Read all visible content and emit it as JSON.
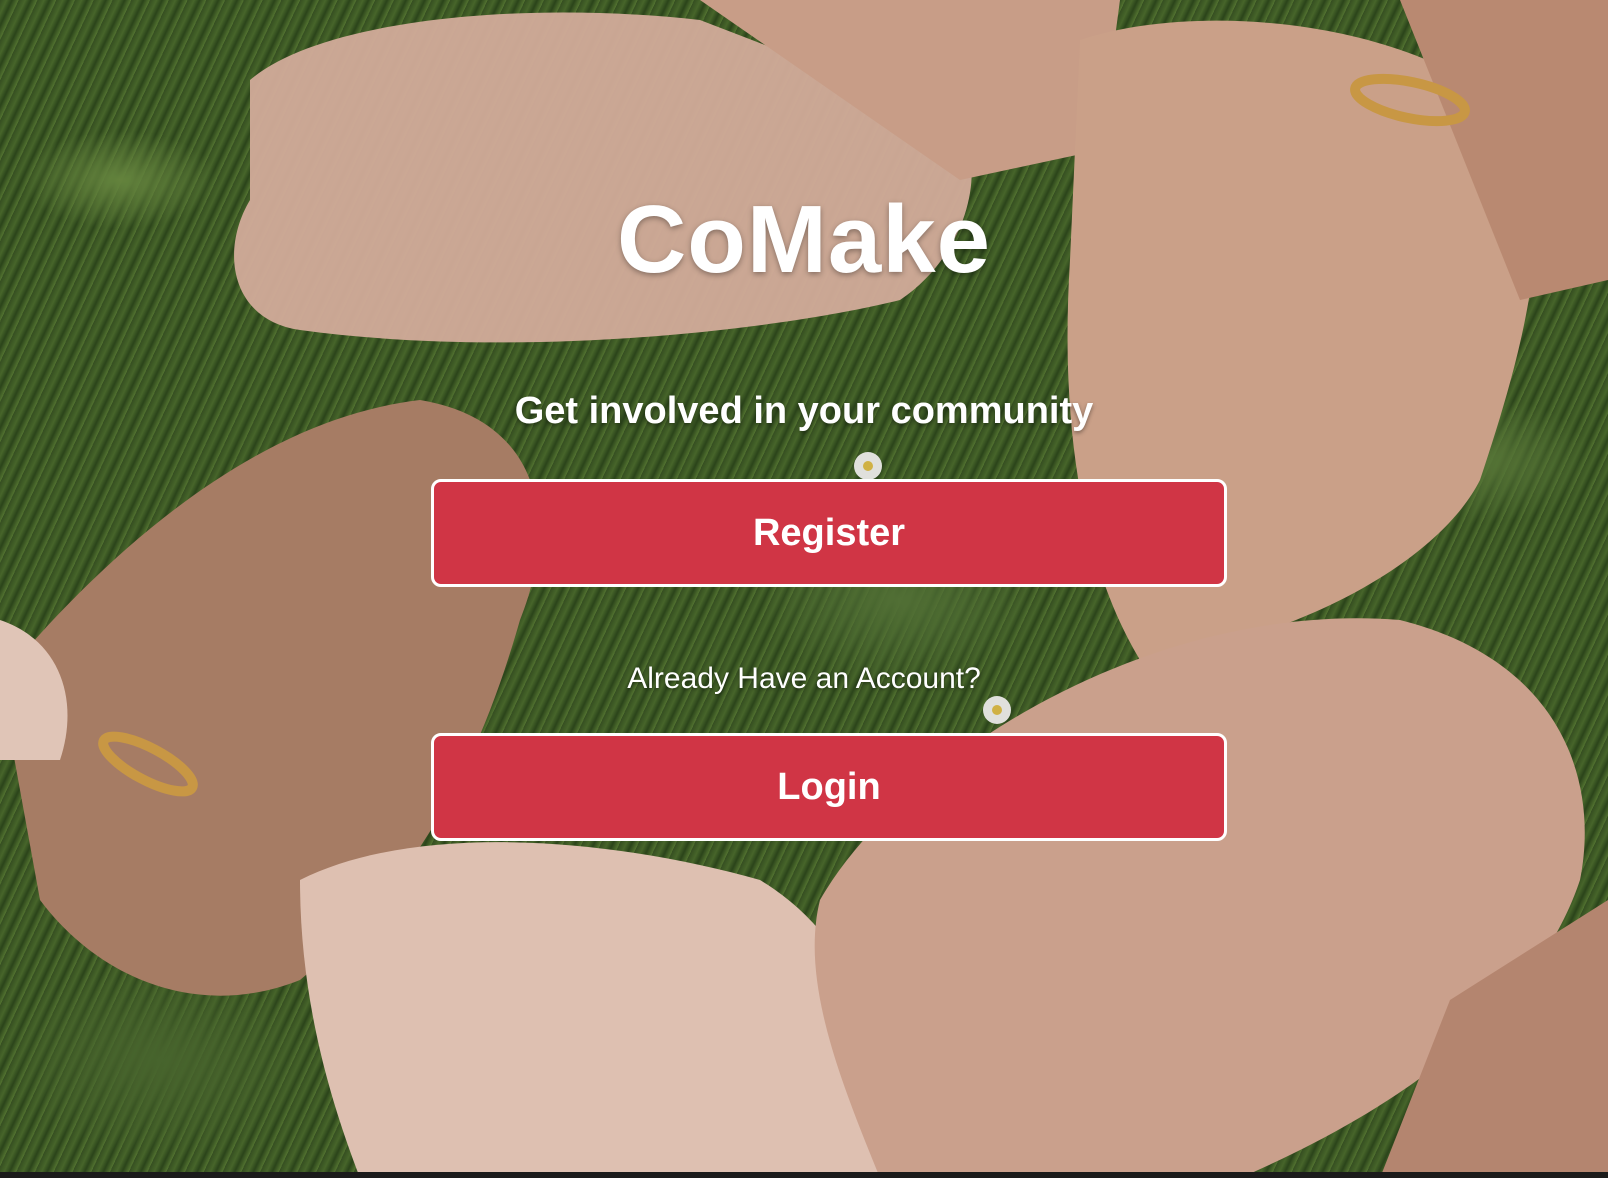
{
  "app": {
    "title": "CoMake",
    "tagline": "Get involved in your community"
  },
  "actions": {
    "register_label": "Register",
    "already_have_account": "Already Have an Account?",
    "login_label": "Login"
  },
  "colors": {
    "button_fill": "#d03545",
    "button_border": "#ffffff",
    "text": "#ffffff"
  }
}
